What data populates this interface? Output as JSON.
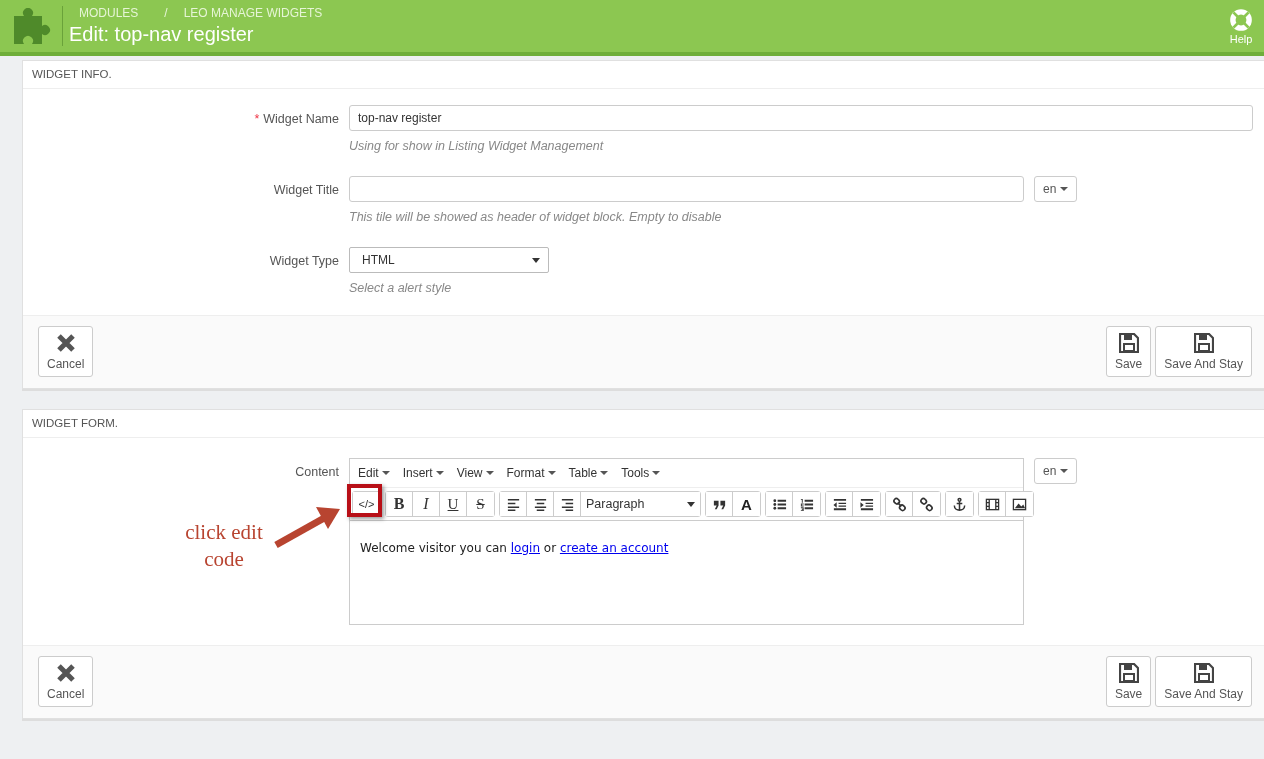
{
  "header": {
    "breadcrumbs": [
      "MODULES",
      "LEO MANAGE WIDGETS"
    ],
    "separator": "/",
    "title": "Edit: top-nav register",
    "help": "Help"
  },
  "panels": [
    {
      "title": "WIDGET INFO.",
      "fields": [
        {
          "kind": "text",
          "label": "Widget Name",
          "required_mark": "*",
          "value": "top-nav register",
          "hint": "Using for show in Listing Widget Management"
        },
        {
          "kind": "text_lang",
          "label": "Widget Title",
          "lang": "en",
          "hint": "This tile will be showed as header of widget block. Empty to disable"
        },
        {
          "kind": "select",
          "label": "Widget Type",
          "value": "HTML",
          "hint": "Select a alert style"
        }
      ],
      "footer": {
        "cancel": "Cancel",
        "save": "Save",
        "save_stay": "Save And Stay"
      }
    },
    {
      "title": "WIDGET FORM.",
      "fields": [
        {
          "kind": "editor",
          "label": "Content",
          "lang": "en",
          "menu": [
            "Edit",
            "Insert",
            "View",
            "Format",
            "Table",
            "Tools"
          ],
          "toolbar": [
            [
              {
                "kind": "code",
                "glyph": "</>"
              }
            ],
            [
              {
                "kind": "bold",
                "glyph": "B"
              },
              {
                "kind": "italic",
                "glyph": "I"
              },
              {
                "kind": "underline",
                "glyph": "U"
              },
              {
                "kind": "strike",
                "glyph": "S"
              }
            ],
            [
              {
                "kind": "align-left"
              },
              {
                "kind": "align-center"
              },
              {
                "kind": "align-right"
              },
              {
                "kind": "format",
                "glyph": "Paragraph"
              }
            ],
            [
              {
                "kind": "quote"
              },
              {
                "kind": "color",
                "glyph": "A"
              }
            ],
            [
              {
                "kind": "bullets"
              },
              {
                "kind": "numbers"
              }
            ],
            [
              {
                "kind": "outdent"
              },
              {
                "kind": "indent"
              }
            ],
            [
              {
                "kind": "link"
              },
              {
                "kind": "unlink"
              }
            ],
            [
              {
                "kind": "anchor"
              }
            ],
            [
              {
                "kind": "media"
              },
              {
                "kind": "image"
              }
            ]
          ],
          "content": [
            {
              "kind": "text",
              "text": "Welcome visitor you can "
            },
            {
              "kind": "link",
              "text": "login"
            },
            {
              "kind": "text",
              "text": " or "
            },
            {
              "kind": "link",
              "text": "create an account"
            }
          ]
        }
      ],
      "footer": {
        "cancel": "Cancel",
        "save": "Save",
        "save_stay": "Save And Stay"
      }
    }
  ],
  "annotation": {
    "text": "click edit\ncode"
  }
}
